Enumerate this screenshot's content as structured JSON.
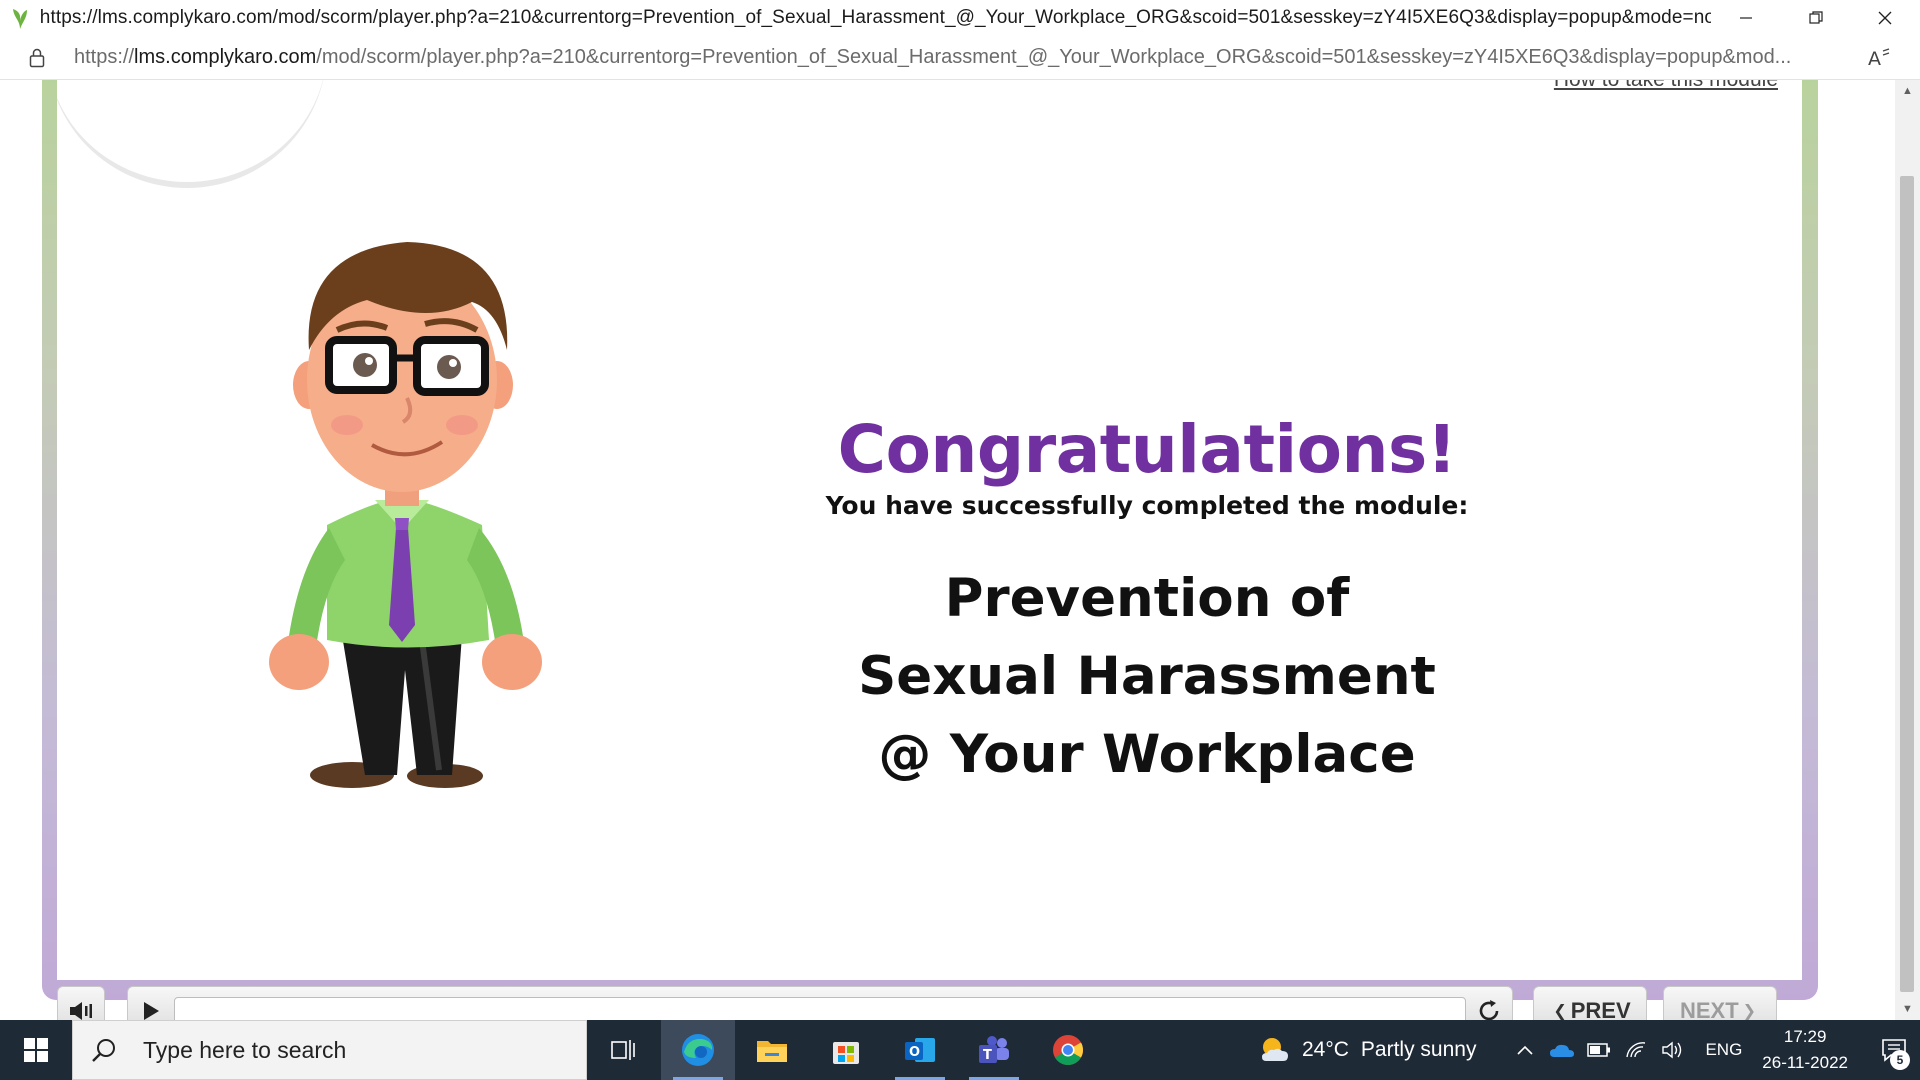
{
  "window": {
    "title": "https://lms.complykaro.com/mod/scorm/player.php?a=210&currentorg=Prevention_of_Sexual_Harassment_@_Your_Workplace_ORG&scoid=501&sesskey=zY4I5XE6Q3&display=popup&mode=normal - Work...",
    "icons": {
      "app": "complykaro-leaf-icon",
      "minimize": "minimize-icon",
      "restore": "restore-icon",
      "close": "close-icon"
    }
  },
  "addressbar": {
    "scheme": "https://",
    "domain": "lms.complykaro.com",
    "path": "/mod/scorm/player.php?a=210&currentorg=Prevention_of_Sexual_Harassment_@_Your_Workplace_ORG&scoid=501&sesskey=zY4I5XE6Q3&display=popup&mod...",
    "read_aloud": "Á"
  },
  "slide": {
    "help_link": "How to take this module",
    "headline": "Congratulations!",
    "subline": "You have successfully completed the module:",
    "module_lines": [
      "Prevention of",
      "Sexual Harassment",
      "@ Your Workplace"
    ]
  },
  "controls": {
    "prev_label": "PREV",
    "next_label": "NEXT",
    "progress": 0
  },
  "taskbar": {
    "search_placeholder": "Type here to search",
    "apps": [
      "task-view",
      "microsoft-edge",
      "file-explorer",
      "microsoft-store",
      "outlook",
      "teams",
      "chrome"
    ],
    "weather": {
      "temp": "24°C",
      "condition": "Partly sunny"
    },
    "language": "ENG",
    "time": "17:29",
    "date": "26-11-2022",
    "notification_count": "5"
  },
  "colors": {
    "headline": "#7030a0",
    "frame_top": "#b7d39a",
    "frame_bottom": "#c0a9d6",
    "taskbar": "#1f2a37"
  }
}
